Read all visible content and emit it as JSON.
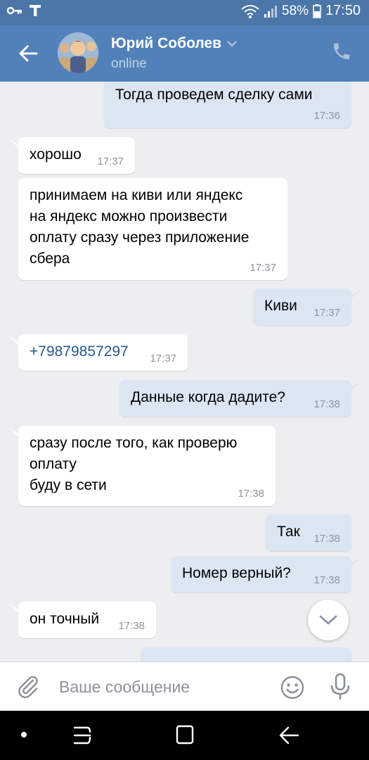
{
  "status_bar": {
    "battery": "58%",
    "time": "17:50"
  },
  "header": {
    "contact_name": "Юрий Соболев",
    "status": "online"
  },
  "messages": [
    {
      "dir": "out",
      "text": "Тогда проведем сделку сами",
      "time": "17:36"
    },
    {
      "dir": "in",
      "text": "хорошо",
      "time": "17:37"
    },
    {
      "dir": "in",
      "text": "принимаем на киви или яндекс\nна яндекс можно произвести\nоплату сразу через приложение\nсбера",
      "time": "17:37"
    },
    {
      "dir": "out",
      "text": "Киви",
      "time": "17:37"
    },
    {
      "dir": "in",
      "text": "+79879857297",
      "time": "17:37"
    },
    {
      "dir": "out",
      "text": "Данные когда дадите?",
      "time": "17:38"
    },
    {
      "dir": "in",
      "text": "сразу после того, как проверю\nоплату\nбуду в сети",
      "time": "17:38"
    },
    {
      "dir": "out",
      "text": "Так",
      "time": "17:38"
    },
    {
      "dir": "out",
      "text": "Номер верный?",
      "time": "17:38"
    },
    {
      "dir": "in",
      "text": "он точный",
      "time": "17:38"
    }
  ],
  "composer": {
    "placeholder": "Ваше сообщение"
  },
  "colors": {
    "header": "#5181b8",
    "status_bar": "#4a76a8",
    "outgoing": "#dce6f3",
    "incoming": "#ffffff",
    "background": "#edeef0",
    "link": "#2a5885"
  },
  "icons": [
    "key-icon",
    "t-icon",
    "wifi-icon",
    "signal-icon",
    "battery-icon",
    "back-arrow-icon",
    "chevron-down-icon",
    "phone-icon",
    "attach-icon",
    "emoji-icon",
    "mic-icon",
    "scroll-down-icon"
  ]
}
